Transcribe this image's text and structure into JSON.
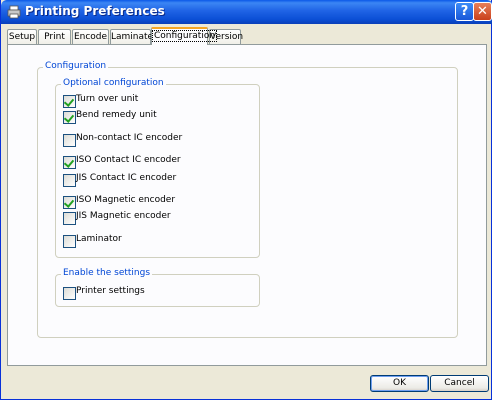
{
  "window": {
    "title": "Printing Preferences",
    "help_label": "?",
    "close_label": "✕"
  },
  "tabs": [
    {
      "label": "Setup"
    },
    {
      "label": "Print"
    },
    {
      "label": "Encode"
    },
    {
      "label": "Laminate"
    },
    {
      "label": "Configuration",
      "active": true
    },
    {
      "label": "Version"
    }
  ],
  "configuration": {
    "title": "Configuration",
    "optional": {
      "title": "Optional configuration",
      "items": [
        {
          "label": "Turn over unit",
          "checked": true
        },
        {
          "label": "Bend remedy unit",
          "checked": true
        },
        {
          "label": "Non-contact IC encoder",
          "checked": false
        },
        {
          "label": "ISO Contact IC encoder",
          "checked": true
        },
        {
          "label": "JIS Contact IC encoder",
          "checked": false
        },
        {
          "label": "ISO Magnetic encoder",
          "checked": true
        },
        {
          "label": "JIS Magnetic encoder",
          "checked": false
        },
        {
          "label": "Laminator",
          "checked": false
        }
      ]
    },
    "enable": {
      "title": "Enable the settings",
      "items": [
        {
          "label": "Printer settings",
          "checked": false
        }
      ]
    }
  },
  "buttons": {
    "ok": "OK",
    "cancel": "Cancel"
  },
  "colors": {
    "titlebar": "#0a58e8",
    "group_label": "#0046d5",
    "check": "#21a121",
    "active_tab_accent": "#f5a623"
  }
}
